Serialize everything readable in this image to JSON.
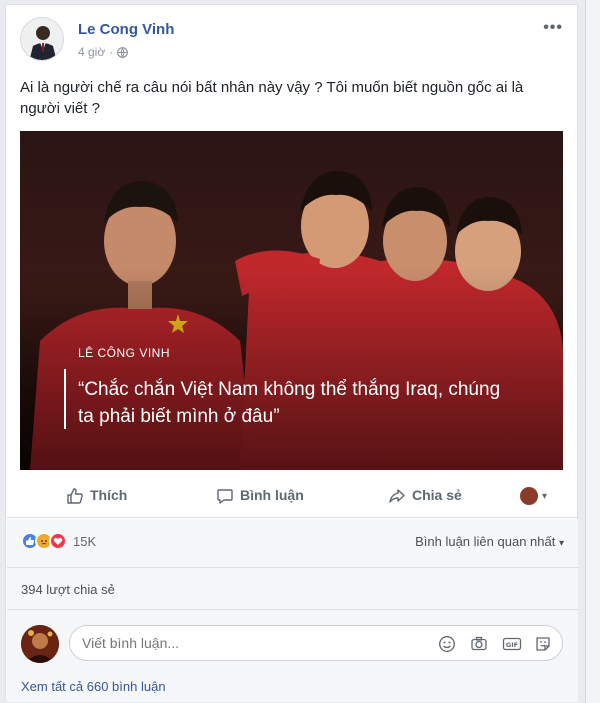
{
  "post": {
    "author_name": "Le Cong Vinh",
    "time": "4 giờ",
    "time_separator": "·",
    "more_label": "•••",
    "text": "Ai là người chế ra câu nói bất nhân này vậy ? Tôi muốn biết nguồn gốc ai là người viết ?"
  },
  "photo": {
    "label": "LÊ CÔNG VINH",
    "quote": "“Chắc chắn Việt Nam không thể thắng Iraq, chúng ta phải biết mình ở đâu”"
  },
  "actions": {
    "like": "Thích",
    "comment": "Bình luận",
    "share": "Chia sẻ",
    "caret": "▾"
  },
  "stats": {
    "reaction_count": "15K",
    "sort_label": "Bình luận liên quan nhất",
    "sort_caret": "▾",
    "shares": "394 lượt chia sẻ"
  },
  "comment_box": {
    "placeholder": "Viết bình luận..."
  },
  "view_all_comments": "Xem tất cả 660 bình luận",
  "icons": {
    "like": "thumbs-up-icon",
    "comment": "speech-bubble-icon",
    "share": "share-arrow-icon",
    "globe": "globe-icon",
    "emoji": "smiley-icon",
    "camera": "camera-icon",
    "gif": "gif-icon",
    "sticker": "sticker-icon"
  },
  "colors": {
    "link_blue": "#365899",
    "meta_gray": "#90949c",
    "like_blue": "#4c7ee8",
    "angry_orange": "#f0a830",
    "love_red": "#f0384c"
  }
}
